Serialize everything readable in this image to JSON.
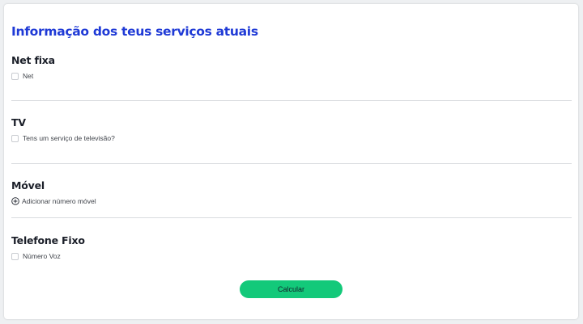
{
  "page": {
    "title": "Informação dos teus serviços atuais"
  },
  "sections": {
    "net_fixa": {
      "title": "Net fixa",
      "option_label": "Net"
    },
    "tv": {
      "title": "TV",
      "option_label": "Tens um serviço de televisão?"
    },
    "movel": {
      "title": "Móvel",
      "add_label": "Adicionar número móvel",
      "add_icon": "plus-circle-icon"
    },
    "telefone_fixo": {
      "title": "Telefone Fixo",
      "option_label": "Número Voz"
    }
  },
  "actions": {
    "calculate_label": "Calcular"
  },
  "colors": {
    "title": "#1f3ad6",
    "button": "#13c97a",
    "divider": "#dadcdf"
  }
}
